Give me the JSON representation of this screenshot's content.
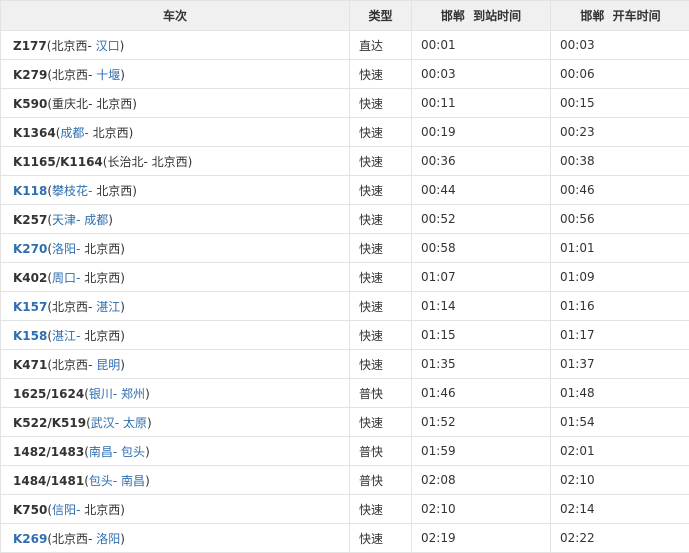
{
  "table": {
    "headers": {
      "train": "车次",
      "type": "类型",
      "arrive": "邯郸  到站时间",
      "depart": "邯郸  开车时间"
    },
    "rows": [
      {
        "train": "Z177",
        "train_link": false,
        "origin": "北京西",
        "origin_link": false,
        "dest": "汉口",
        "dest_link": true,
        "type": "直达",
        "arrive": "00:01",
        "depart": "00:03"
      },
      {
        "train": "K279",
        "train_link": false,
        "origin": "北京西",
        "origin_link": false,
        "dest": "十堰",
        "dest_link": true,
        "type": "快速",
        "arrive": "00:03",
        "depart": "00:06"
      },
      {
        "train": "K590",
        "train_link": false,
        "origin": "重庆北",
        "origin_link": false,
        "dest": "北京西",
        "dest_link": false,
        "type": "快速",
        "arrive": "00:11",
        "depart": "00:15"
      },
      {
        "train": "K1364",
        "train_link": false,
        "origin": "成都",
        "origin_link": true,
        "dest": "北京西",
        "dest_link": false,
        "type": "快速",
        "arrive": "00:19",
        "depart": "00:23"
      },
      {
        "train": "K1165/K1164",
        "train_link": false,
        "origin": "长治北",
        "origin_link": false,
        "dest": "北京西",
        "dest_link": false,
        "type": "快速",
        "arrive": "00:36",
        "depart": "00:38"
      },
      {
        "train": "K118",
        "train_link": true,
        "origin": "攀枝花",
        "origin_link": true,
        "dest": "北京西",
        "dest_link": false,
        "type": "快速",
        "arrive": "00:44",
        "depart": "00:46"
      },
      {
        "train": "K257",
        "train_link": false,
        "origin": "天津",
        "origin_link": true,
        "dest": "成都",
        "dest_link": true,
        "type": "快速",
        "arrive": "00:52",
        "depart": "00:56"
      },
      {
        "train": "K270",
        "train_link": true,
        "origin": "洛阳",
        "origin_link": true,
        "dest": "北京西",
        "dest_link": false,
        "type": "快速",
        "arrive": "00:58",
        "depart": "01:01"
      },
      {
        "train": "K402",
        "train_link": false,
        "origin": "周口",
        "origin_link": true,
        "dest": "北京西",
        "dest_link": false,
        "type": "快速",
        "arrive": "01:07",
        "depart": "01:09"
      },
      {
        "train": "K157",
        "train_link": true,
        "origin": "北京西",
        "origin_link": false,
        "dest": "湛江",
        "dest_link": true,
        "type": "快速",
        "arrive": "01:14",
        "depart": "01:16"
      },
      {
        "train": "K158",
        "train_link": true,
        "origin": "湛江",
        "origin_link": true,
        "dest": "北京西",
        "dest_link": false,
        "type": "快速",
        "arrive": "01:15",
        "depart": "01:17"
      },
      {
        "train": "K471",
        "train_link": false,
        "origin": "北京西",
        "origin_link": false,
        "dest": "昆明",
        "dest_link": true,
        "type": "快速",
        "arrive": "01:35",
        "depart": "01:37"
      },
      {
        "train": "1625/1624",
        "train_link": false,
        "origin": "银川",
        "origin_link": true,
        "dest": "郑州",
        "dest_link": true,
        "type": "普快",
        "arrive": "01:46",
        "depart": "01:48"
      },
      {
        "train": "K522/K519",
        "train_link": false,
        "origin": "武汉",
        "origin_link": true,
        "dest": "太原",
        "dest_link": true,
        "type": "快速",
        "arrive": "01:52",
        "depart": "01:54"
      },
      {
        "train": "1482/1483",
        "train_link": false,
        "origin": "南昌",
        "origin_link": true,
        "dest": "包头",
        "dest_link": true,
        "type": "普快",
        "arrive": "01:59",
        "depart": "02:01"
      },
      {
        "train": "1484/1481",
        "train_link": false,
        "origin": "包头",
        "origin_link": true,
        "dest": "南昌",
        "dest_link": true,
        "type": "普快",
        "arrive": "02:08",
        "depart": "02:10"
      },
      {
        "train": "K750",
        "train_link": false,
        "origin": "信阳",
        "origin_link": true,
        "dest": "北京西",
        "dest_link": false,
        "type": "快速",
        "arrive": "02:10",
        "depart": "02:14"
      },
      {
        "train": "K269",
        "train_link": true,
        "origin": "北京西",
        "origin_link": false,
        "dest": "洛阳",
        "dest_link": true,
        "type": "快速",
        "arrive": "02:19",
        "depart": "02:22"
      }
    ]
  },
  "colors": {
    "link": "#2e6eb0",
    "text": "#333333",
    "header_bg": "#f0f0f0",
    "border": "#e3e3e3"
  }
}
